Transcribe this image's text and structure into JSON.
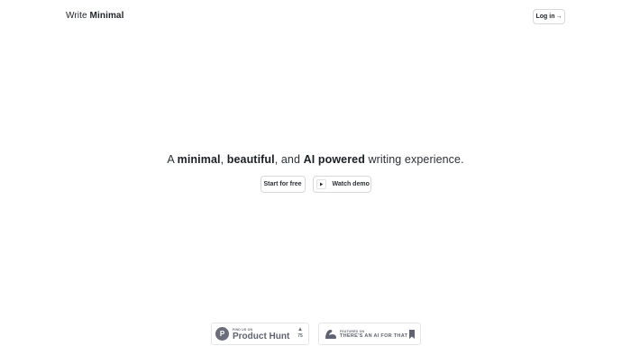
{
  "header": {
    "logo_prefix": "Write",
    "logo_strong": "Minimal",
    "login_label": "Log in",
    "login_arrow": "→"
  },
  "hero": {
    "p1": "A ",
    "b1": "minimal",
    "p2": ", ",
    "b2": "beautiful",
    "p3": ", and ",
    "b3": "AI powered",
    "p4": " writing experience."
  },
  "cta": {
    "start_label": "Start for free",
    "demo_label": "Watch demo",
    "demo_icon": "play-icon"
  },
  "badges": {
    "product_hunt": {
      "logo_letter": "P",
      "small": "FIND US ON",
      "big": "Product Hunt",
      "vote_icon": "▲",
      "votes": "75"
    },
    "aift": {
      "small": "FEATURED ON",
      "big": "THERE'S AN AI FOR THAT",
      "icon": "bookmark-icon"
    }
  },
  "colors": {
    "text": "#1f2328",
    "border": "#d7d9dc",
    "badge_gray": "#5f6270"
  }
}
